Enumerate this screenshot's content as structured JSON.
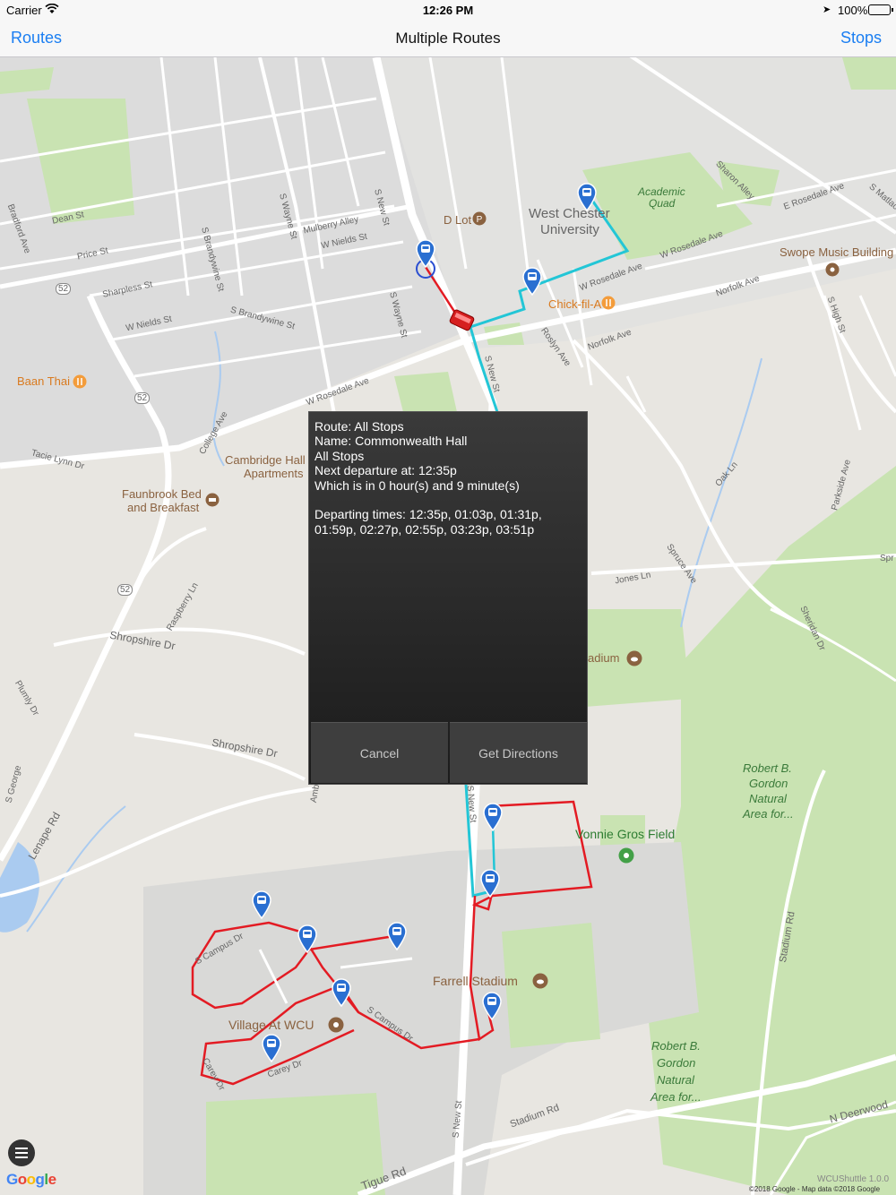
{
  "status_bar": {
    "carrier": "Carrier",
    "time": "12:26 PM",
    "battery": "100%"
  },
  "nav": {
    "left_button": "Routes",
    "title": "Multiple Routes",
    "right_button": "Stops"
  },
  "map": {
    "places": {
      "d_lot": "D Lot",
      "wcu_line1": "West Chester",
      "wcu_line2": "University",
      "academic_quad_line1": "Academic",
      "academic_quad_line2": "Quad",
      "swope": "Swope Music Building",
      "chick_fil_a": "Chick-fil-A",
      "baan_thai": "Baan Thai",
      "cambridge_line1": "Cambridge Hall",
      "cambridge_line2": "Apartments",
      "faunbrook_line1": "Faunbrook Bed",
      "faunbrook_line2": "and Breakfast",
      "stadium_partial": "adium",
      "robert_gordon_line1": "Robert B.",
      "robert_gordon_line2": "Gordon",
      "robert_gordon_line3": "Natural",
      "robert_gordon_line4": "Area for...",
      "vonnie_gros": "Vonnie Gros Field",
      "farrell_stadium": "Farrell Stadium",
      "village_wcu": "Village At WCU"
    },
    "streets": {
      "dean": "Dean St",
      "price": "Price St",
      "sharpless": "Sharpless St",
      "w_nields": "W Nields St",
      "w_nields_2": "W Nields St",
      "mulberry": "Mulberry Alley",
      "s_wayne": "S Wayne St",
      "s_wayne_2": "S Wayne St",
      "s_new": "S New St",
      "s_new_2": "S New St",
      "s_new_3": "S New St",
      "s_new_4": "S New St",
      "s_brandywine": "S Brandywine St",
      "s_brandywine_2": "S Brandywine St",
      "w_rosedale": "W Rosedale Ave",
      "w_rosedale_2": "W Rosedale Ave",
      "w_rosedale_3": "W Rosedale Ave",
      "e_rosedale": "E Rosedale Ave",
      "norfolk": "Norfolk Ave",
      "norfolk_2": "Norfolk Ave",
      "roslyn": "Roslyn Ave",
      "s_high": "S High St",
      "sharon": "Sharon Alley",
      "s_matlack": "S Matlack",
      "bradford": "Bradford Ave",
      "college": "College Ave",
      "tacie_lynn": "Tacie Lynn Dr",
      "raspberry": "Raspberry Ln",
      "shropshire": "Shropshire Dr",
      "shropshire_2": "Shropshire Dr",
      "plumly": "Plumly Dr",
      "lenape": "Lenape Rd",
      "s_george": "S George",
      "jones": "Jones Ln",
      "spruce": "Spruce Ave",
      "oak": "Oak Ln",
      "parkside": "Parkside Ave",
      "sheridan": "Sheridan Dr",
      "stadium_rd": "Stadium Rd",
      "stadium_rd_2": "Stadium Rd",
      "n_deerwood": "N Deerwood",
      "tigue": "Tigue Rd",
      "s_campus": "S Campus Dr",
      "s_campus_2": "S Campus Dr",
      "carey": "Carey Dr",
      "carey_2": "Carey Dr",
      "amber": "Amber",
      "spr": "Spr",
      "rt52_a": "52",
      "rt52_b": "52",
      "rt52_c": "52"
    },
    "google_logo": "Google",
    "copyright": "©2018 Google - Map data ©2018 Google",
    "version": "WCUShuttle 1.0.0"
  },
  "dialog": {
    "line1": "Route: All Stops",
    "line2": "Name: Commonwealth Hall",
    "line3": "All Stops",
    "line4": "Next departure at: 12:35p",
    "line5": "Which is in 0 hour(s) and 9 minute(s)",
    "line6": "Departing times: 12:35p, 01:03p, 01:31p, 01:59p, 02:27p, 02:55p, 03:23p, 03:51p",
    "cancel": "Cancel",
    "get_directions": "Get Directions"
  },
  "colors": {
    "accent": "#1a7ef2",
    "route_red": "#e31b23",
    "route_cyan": "#23c6d6",
    "pin_blue": "#2a6fd1"
  }
}
